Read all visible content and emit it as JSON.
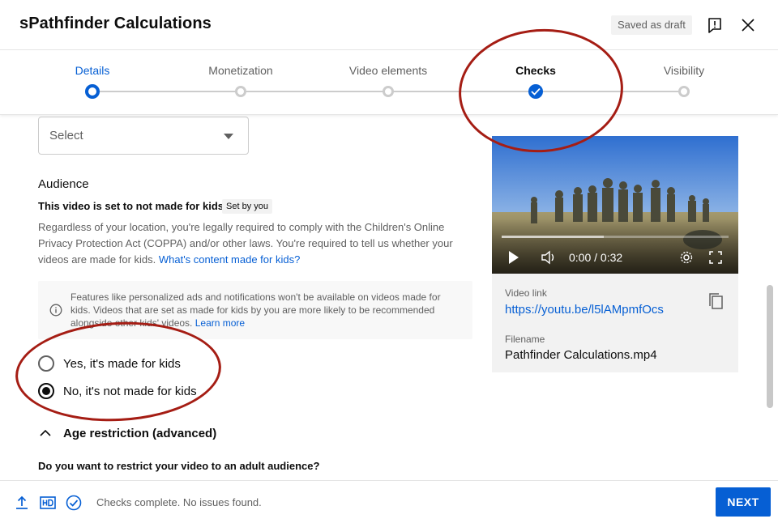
{
  "header": {
    "title": "sPathfinder Calculations",
    "saved_badge": "Saved as draft",
    "feedback_icon": "feedback-icon",
    "close_icon": "close-icon"
  },
  "stepper": {
    "steps": [
      {
        "label": "Details",
        "state": "current"
      },
      {
        "label": "Monetization",
        "state": "pending"
      },
      {
        "label": "Video elements",
        "state": "pending"
      },
      {
        "label": "Checks",
        "state": "done"
      },
      {
        "label": "Visibility",
        "state": "pending"
      }
    ]
  },
  "category_select": {
    "value": "Select"
  },
  "audience": {
    "heading": "Audience",
    "status": "This video is set to not made for kids",
    "set_by_badge": "Set by you",
    "description": "Regardless of your location, you're legally required to comply with the Children's Online Privacy Protection Act (COPPA) and/or other laws. You're required to tell us whether your videos are made for kids.",
    "help_link": "What's content made for kids?",
    "info_text": "Features like personalized ads and notifications won't be available on videos made for kids. Videos that are set as made for kids by you are more likely to be recommended alongside other kids' videos.",
    "learn_more": "Learn more",
    "options": [
      {
        "label": "Yes, it's made for kids",
        "checked": false
      },
      {
        "label": "No, it's not made for kids",
        "checked": true
      }
    ]
  },
  "age_restriction": {
    "label": "Age restriction (advanced)",
    "question": "Do you want to restrict your video to an adult audience?"
  },
  "video_card": {
    "time": "0:00 / 0:32",
    "progress": 0.0,
    "link_label": "Video link",
    "link": "https://youtu.be/l5lAMpmfOcs",
    "filename_label": "Filename",
    "filename": "Pathfinder Calculations.mp4"
  },
  "footer": {
    "status": "Checks complete. No issues found.",
    "next_label": "NEXT"
  },
  "colors": {
    "accent": "#065fd4",
    "annotation": "#a51d14"
  }
}
